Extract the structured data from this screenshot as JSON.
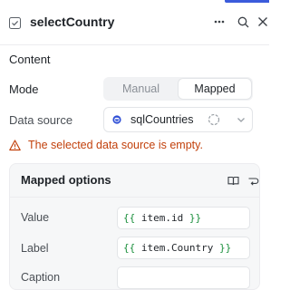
{
  "header": {
    "title": "selectCountry"
  },
  "section": {
    "content_label": "Content"
  },
  "mode": {
    "label": "Mode",
    "options": [
      "Manual",
      "Mapped"
    ],
    "selected": "Mapped"
  },
  "data_source": {
    "label": "Data source",
    "value": "sqlCountries"
  },
  "warning": {
    "text": "The selected data source is empty."
  },
  "mapped_options": {
    "title": "Mapped options",
    "fields": [
      {
        "label": "Value",
        "open": "{{",
        "expr": " item.id ",
        "close": "}}"
      },
      {
        "label": "Label",
        "open": "{{",
        "expr": " item.Country ",
        "close": "}}"
      },
      {
        "label": "Caption",
        "open": "",
        "expr": "",
        "close": ""
      }
    ]
  },
  "colors": {
    "accent": "#3b5bdb",
    "warning": "#c2410c",
    "code_brace": "#1a8f3c"
  },
  "icons": [
    "select-component-icon",
    "more-icon",
    "search-icon",
    "close-icon",
    "database-icon",
    "loading-icon",
    "chevron-down-icon",
    "warning-icon",
    "book-icon",
    "wrap-icon"
  ]
}
